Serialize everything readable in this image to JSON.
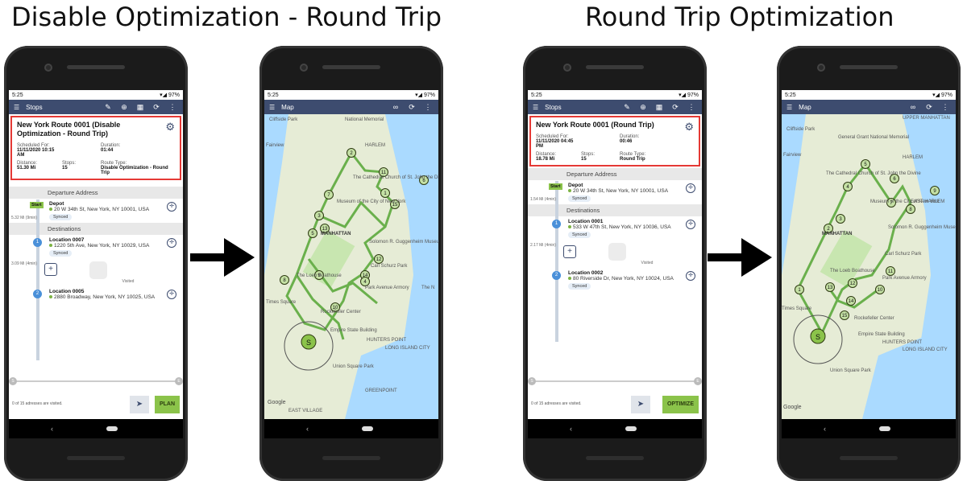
{
  "headings": {
    "left": "Disable Optimization - Round Trip",
    "right": "Round Trip Optimization"
  },
  "status": {
    "time": "5:25",
    "battery": "97%"
  },
  "icons": {
    "menu": "menu-icon",
    "edit": "edit-icon",
    "add": "add-icon",
    "map": "map-icon",
    "optimize": "optimize-icon",
    "more": "more-icon",
    "gear": "gear-icon",
    "navigate": "navigate-icon"
  },
  "colors": {
    "appbar": "#3d4c6f",
    "accent_green": "#8bc34a",
    "route": "#6ab04c",
    "highlight": "#e53935"
  },
  "phone1": {
    "screen_title": "Stops",
    "route_name": "New York Route 0001 (Disable Optimization - Round Trip)",
    "scheduled_label": "Scheduled For:",
    "scheduled_value": "11/11/2020 10:15 AM",
    "duration_label": "Duration:",
    "duration_value": "01:44",
    "distance_label": "Distance:",
    "distance_value": "51.30 Mi",
    "stops_label": "Stops:",
    "stops_value": "15",
    "route_type_label": "Route Type:",
    "route_type_value": "Disable Optimization - Round Trip",
    "departure_header": "Departure Address",
    "start_badge": "Start",
    "depot_name": "Depot",
    "depot_address": "20 W 34th St, New York, NY 10001, USA",
    "synced": "Synced",
    "leg1": "5.32 Mi (9min)",
    "destinations_header": "Destinations",
    "stop1_num": "1",
    "stop1_name": "Location 0007",
    "stop1_address": "1220 5th Ave, New York, NY 10029, USA",
    "leg2": "3.09 Mi (4min)",
    "visited": "Visited",
    "stop2_num": "2",
    "stop2_name": "Location 0005",
    "stop2_address": "2880 Broadway, New York, NY 10025, USA",
    "footer": "0 of 15 adresses are visited.",
    "action": "PLAN",
    "s": "S",
    "e": "E"
  },
  "phone2": {
    "screen_title": "Map",
    "marker": "S",
    "labels": [
      "Cliffside Park",
      "National Memorial",
      "Fairview",
      "HARLEM",
      "The Cathedral Church of St. John the Divine",
      "Museum of the City of New York",
      "MANHATTAN",
      "Solomon R. Guggenheim Museum",
      "Carl Schurz Park",
      "The Loeb Boathouse",
      "Park Avenue Armory",
      "The N",
      "Times Square",
      "Rockefeller Center",
      "Empire State Building",
      "HUNTERS POINT",
      "LONG ISLAND CITY",
      "Union Square Park",
      "GREENPOINT",
      "EAST VILLAGE",
      "Google"
    ],
    "numbers": [
      "2",
      "11",
      "7",
      "6",
      "3",
      "1",
      "15",
      "5",
      "13",
      "12",
      "14",
      "9",
      "8",
      "4",
      "10"
    ]
  },
  "phone3": {
    "screen_title": "Stops",
    "route_name": "New York Route 0001 (Round Trip)",
    "scheduled_label": "Scheduled For:",
    "scheduled_value": "11/11/2020 04:45 PM",
    "duration_label": "Duration:",
    "duration_value": "00:46",
    "distance_label": "Distance:",
    "distance_value": "18.78 Mi",
    "stops_label": "Stops:",
    "stops_value": "15",
    "route_type_label": "Route Type:",
    "route_type_value": "Round Trip",
    "departure_header": "Departure Address",
    "start_badge": "Start",
    "depot_name": "Depot",
    "depot_address": "20 W 34th St, New York, NY 10001, USA",
    "synced": "Synced",
    "leg1": "1.54 Mi (4min)",
    "destinations_header": "Destinations",
    "stop1_num": "1",
    "stop1_name": "Location 0001",
    "stop1_address": "533 W 47th St, New York, NY 10036, USA",
    "leg2": "2.17 Mi (4min)",
    "visited": "Visited",
    "stop2_num": "2",
    "stop2_name": "Location 0002",
    "stop2_address": "80 Riverside Dr, New York, NY 10024, USA",
    "footer": "0 of 15 adresses are visited.",
    "action": "OPTIMIZE",
    "s": "S",
    "e": "E"
  },
  "phone4": {
    "screen_title": "Map",
    "marker": "S",
    "labels": [
      "UPPER MANHATTAN",
      "Cliffside Park",
      "General Grant National Memorial",
      "Fairview",
      "HARLEM",
      "The Cathedral Church of St. John the Divine",
      "EAST HARLEM",
      "Museum of the City of New York",
      "MANHATTAN",
      "Solomon R. Guggenheim Museum",
      "Carl Schurz Park",
      "The Loeb Boathouse",
      "Park Avenue Armory",
      "Times Square",
      "Rockefeller Center",
      "Empire State Building",
      "HUNTERS POINT",
      "LONG ISLAND CITY",
      "Union Square Park",
      "Google"
    ],
    "numbers": [
      "5",
      "4",
      "6",
      "9",
      "7",
      "8",
      "3",
      "2",
      "13",
      "12",
      "11",
      "14",
      "1",
      "10",
      "15"
    ]
  }
}
